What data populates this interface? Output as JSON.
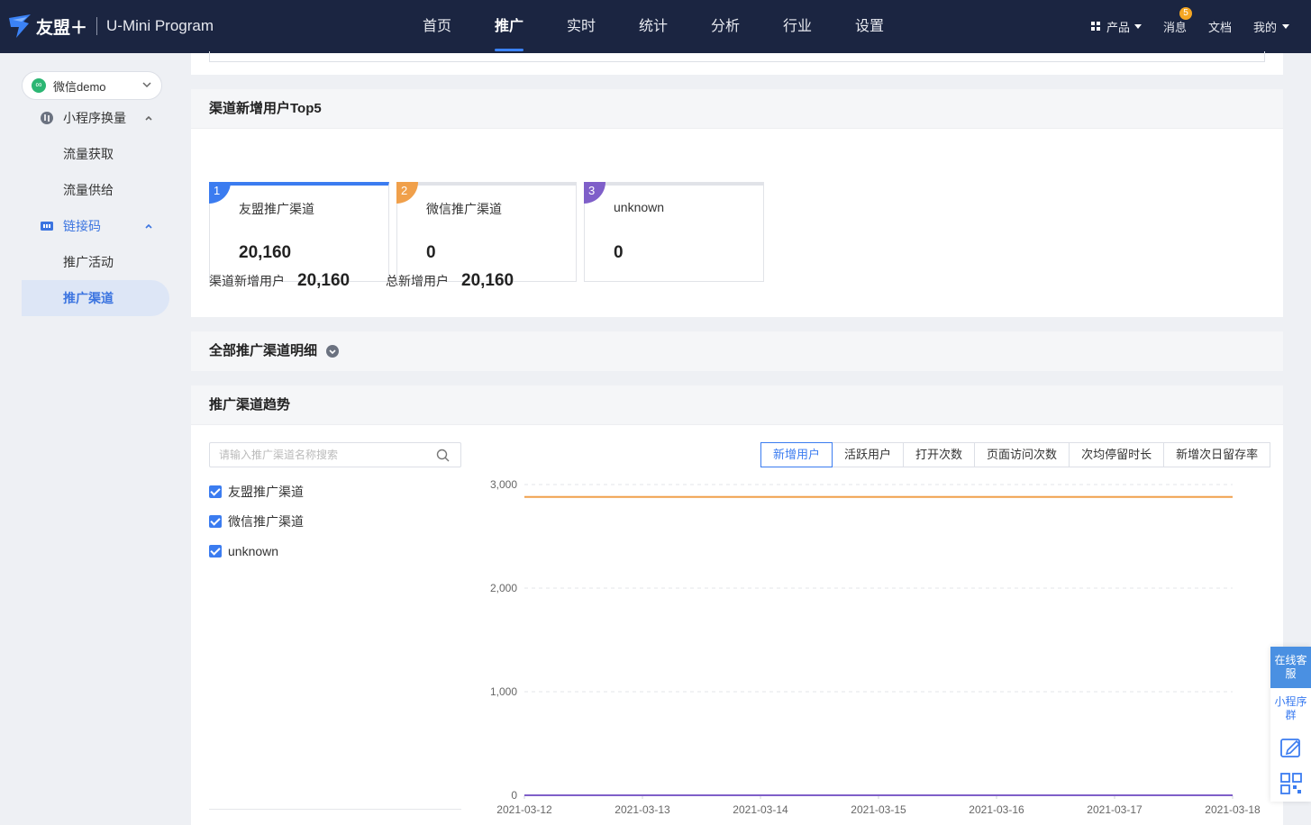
{
  "brand": {
    "name": "友盟＋",
    "product": "U-Mini Program"
  },
  "nav": [
    {
      "label": "首页",
      "active": false
    },
    {
      "label": "推广",
      "active": true
    },
    {
      "label": "实时",
      "active": false
    },
    {
      "label": "统计",
      "active": false
    },
    {
      "label": "分析",
      "active": false
    },
    {
      "label": "行业",
      "active": false
    },
    {
      "label": "设置",
      "active": false
    }
  ],
  "top_right": {
    "products": "产品",
    "messages": "消息",
    "message_count": "5",
    "docs": "文档",
    "mine": "我的"
  },
  "sidebar": {
    "app_name": "微信demo",
    "groups": [
      {
        "label": "小程序换量",
        "items": [
          "流量获取",
          "流量供给"
        ]
      },
      {
        "label": "链接码",
        "items": [
          "推广活动",
          "推广渠道"
        ]
      }
    ],
    "active_item": "推广渠道"
  },
  "top5": {
    "title": "渠道新增用户Top5",
    "cards": [
      {
        "rank": "1",
        "name": "友盟推广渠道",
        "value": "20,160",
        "color": "#3b7cf0"
      },
      {
        "rank": "2",
        "name": "微信推广渠道",
        "value": "0",
        "color": "#f0a04b"
      },
      {
        "rank": "3",
        "name": "unknown",
        "value": "0",
        "color": "#7f5fc9"
      }
    ],
    "summary": [
      {
        "label": "渠道新增用户",
        "value": "20,160"
      },
      {
        "label": "总新增用户",
        "value": "20,160"
      }
    ]
  },
  "detail": {
    "title": "全部推广渠道明细"
  },
  "trend": {
    "title": "推广渠道趋势",
    "search_placeholder": "请输入推广渠道名称搜索",
    "channels": [
      "友盟推广渠道",
      "微信推广渠道",
      "unknown"
    ],
    "metric_tabs": [
      "新增用户",
      "活跃用户",
      "打开次数",
      "页面访问次数",
      "次均停留时长",
      "新增次日留存率"
    ],
    "active_metric": "新增用户"
  },
  "chart_data": {
    "type": "line",
    "x": [
      "2021-03-12",
      "2021-03-13",
      "2021-03-14",
      "2021-03-15",
      "2021-03-16",
      "2021-03-17",
      "2021-03-18"
    ],
    "ylim": [
      0,
      3000
    ],
    "yticks": [
      0,
      1000,
      2000,
      3000
    ],
    "ytick_labels": [
      "0",
      "1,000",
      "2,000",
      "3,000"
    ],
    "series": [
      {
        "name": "友盟推广渠道",
        "color": "#f0a04b",
        "values": [
          2880,
          2880,
          2880,
          2880,
          2880,
          2880,
          2880
        ]
      },
      {
        "name": "微信推广渠道",
        "color": "#3b7cf0",
        "values": [
          0,
          0,
          0,
          0,
          0,
          0,
          0
        ]
      },
      {
        "name": "unknown",
        "color": "#7f5fc9",
        "values": [
          0,
          0,
          0,
          0,
          0,
          0,
          0
        ]
      }
    ],
    "grid": true
  },
  "float_bar": {
    "service": "在线客服",
    "group": "小程序群"
  }
}
